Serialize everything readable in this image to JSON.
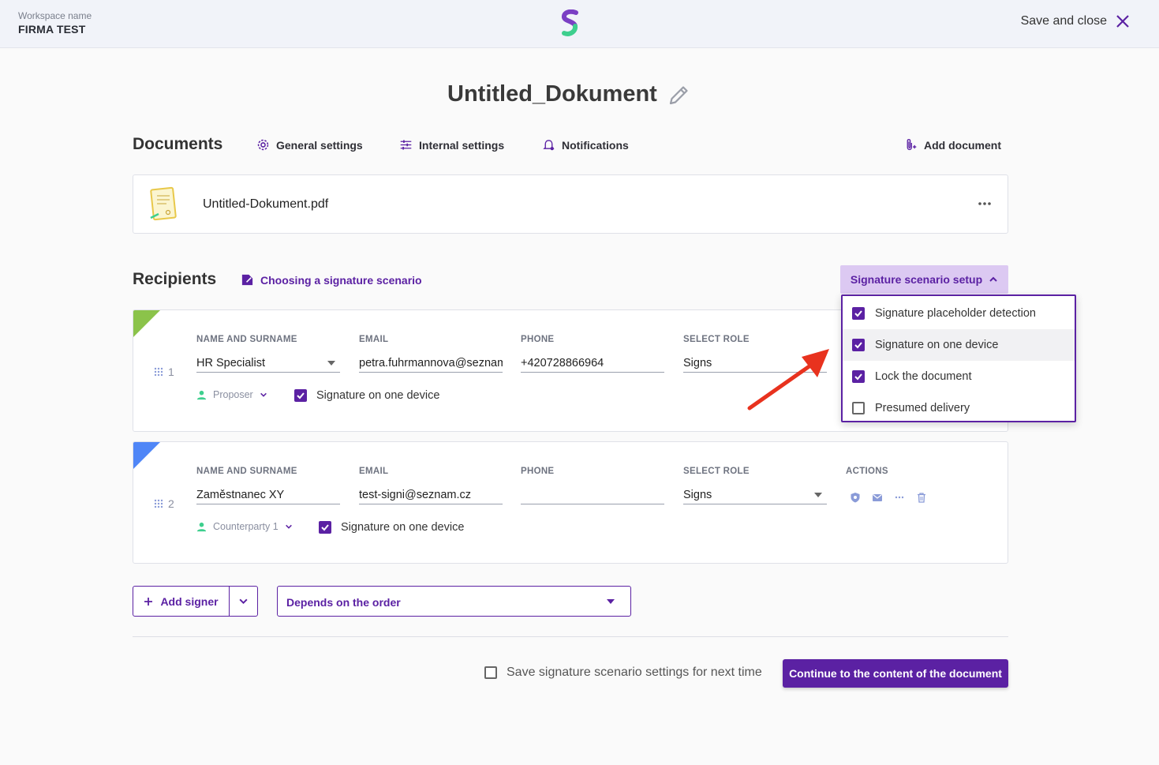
{
  "header": {
    "workspace_label": "Workspace name",
    "workspace_name": "FIRMA TEST",
    "logo_icon": "signi-logo-icon",
    "save_close_label": "Save and close"
  },
  "document": {
    "title": "Untitled_Dokument"
  },
  "documents_section": {
    "heading": "Documents",
    "general_settings": "General settings",
    "internal_settings": "Internal settings",
    "notifications": "Notifications",
    "add_document": "Add document",
    "files": [
      {
        "name": "Untitled-Dokument.pdf"
      }
    ]
  },
  "recipients_section": {
    "heading": "Recipients",
    "scenario_link": "Choosing a signature scenario",
    "scenario_button": "Signature scenario setup",
    "columns": {
      "name": "NAME AND SURNAME",
      "email": "EMAIL",
      "phone": "PHONE",
      "role": "SELECT ROLE",
      "actions": "ACTIONS"
    },
    "recipients": [
      {
        "index": "1",
        "name": "HR Specialist",
        "email": "petra.fuhrmannova@seznam.",
        "phone": "+420728866964",
        "role": "Signs",
        "party": "Proposer",
        "checkbox_label": "Signature on one device",
        "checked": true,
        "corner_color": "#8bc34a"
      },
      {
        "index": "2",
        "name": "Zaměstnanec XY",
        "email": "test-signi@seznam.cz",
        "phone": "",
        "role": "Signs",
        "party": "Counterparty 1",
        "checkbox_label": "Signature on one device",
        "checked": true,
        "corner_color": "#4f86f7"
      }
    ]
  },
  "scenario_menu": {
    "items": [
      {
        "label": "Signature placeholder detection",
        "checked": true
      },
      {
        "label": "Signature on one device",
        "checked": true
      },
      {
        "label": "Lock the document",
        "checked": true
      },
      {
        "label": "Presumed delivery",
        "checked": false
      }
    ]
  },
  "footer": {
    "add_signer": "Add signer",
    "order_select": "Depends on the order",
    "save_settings_label": "Save signature scenario settings for next time",
    "save_settings_checked": false,
    "continue_button": "Continue to the content of the document"
  },
  "colors": {
    "accent": "#5b21a3",
    "accent_light": "#dcc9f2",
    "arrow": "#e8321e"
  }
}
